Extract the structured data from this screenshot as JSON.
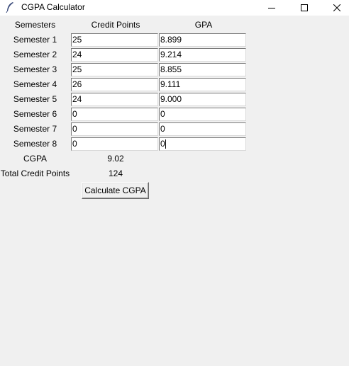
{
  "window": {
    "title": "CGPA Calculator",
    "icon": "feather-icon",
    "controls": [
      "minimize-icon",
      "maximize-icon",
      "close-icon"
    ]
  },
  "headers": {
    "semesters": "Semesters",
    "credit_points": "Credit Points",
    "gpa": "GPA"
  },
  "semesters": [
    {
      "label": "Semester 1",
      "credit": "25",
      "gpa": "8.899"
    },
    {
      "label": "Semester 2",
      "credit": "24",
      "gpa": "9.214"
    },
    {
      "label": "Semester 3",
      "credit": "25",
      "gpa": "8.855"
    },
    {
      "label": "Semester 4",
      "credit": "26",
      "gpa": "9.111"
    },
    {
      "label": "Semester 5",
      "credit": "24",
      "gpa": "9.000"
    },
    {
      "label": "Semester 6",
      "credit": "0",
      "gpa": "0"
    },
    {
      "label": "Semester 7",
      "credit": "0",
      "gpa": "0"
    },
    {
      "label": "Semester 8",
      "credit": "0",
      "gpa": "0"
    }
  ],
  "results": {
    "cgpa_label": "CGPA",
    "cgpa_value": "9.02",
    "total_label": "Total Credit Points",
    "total_value": "124"
  },
  "actions": {
    "calculate_label": "Calculate CGPA"
  },
  "colors": {
    "background": "#f0f0f0",
    "titlebar": "#ffffff",
    "entry_bg": "#ffffff"
  }
}
